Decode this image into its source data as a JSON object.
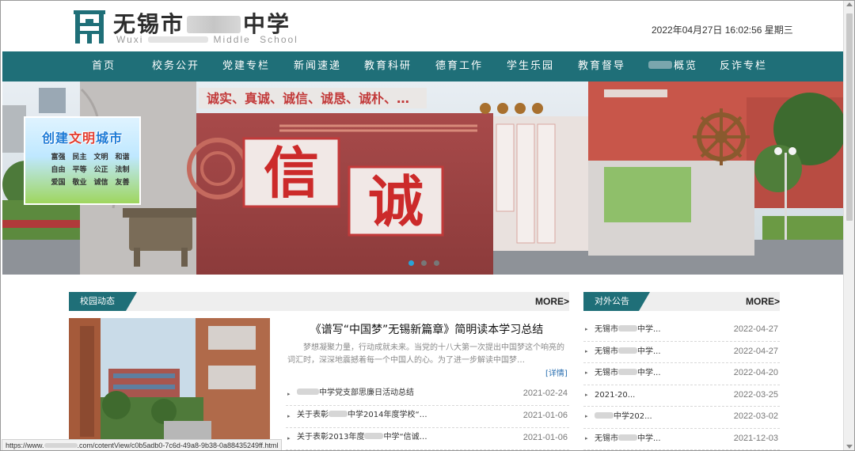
{
  "header": {
    "title_prefix": "无锡市",
    "title_suffix": "中学",
    "subtitle_prefix": "Wuxi",
    "subtitle_suffix": "Middle School",
    "datetime": "2022年04月27日 16:02:56 星期三",
    "logo_icon": "school-gate-logo-icon"
  },
  "nav": {
    "items": [
      {
        "label": "首页"
      },
      {
        "label": "校务公开"
      },
      {
        "label": "党建专栏"
      },
      {
        "label": "新闻速递"
      },
      {
        "label": "教育科研"
      },
      {
        "label": "德育工作"
      },
      {
        "label": "学生乐园"
      },
      {
        "label": "教育督导"
      },
      {
        "label": "概览"
      },
      {
        "label": "反诈专栏"
      }
    ],
    "color": "#1f6f78"
  },
  "banner": {
    "slogan_top": "诚实、真诚、诚信、诚恳、诚朴、…",
    "char_1": "信",
    "char_2": "诚",
    "civ_title_a": "创建",
    "civ_title_b": "文明",
    "civ_title_c": "城市",
    "civ_words": [
      "富强",
      "民主",
      "文明",
      "和谐",
      "自由",
      "平等",
      "公正",
      "法制",
      "爱国",
      "敬业",
      "诚信",
      "友善"
    ],
    "slide_count": 3,
    "active_slide": 1
  },
  "campus_news": {
    "tab_label": "校园动态",
    "more_label": "MORE>",
    "feature": {
      "title": "《谱写“中国梦”无锡新篇章》简明读本学习总结",
      "body": "梦想凝聚力量，行动成就未来。当党的十八大第一次提出中国梦这个响亮的词汇时，深深地震撼着每一个中国人的心。为了进一步解读中国梦…",
      "detail_label": "[详情]"
    },
    "items": [
      {
        "title": "中学党支部思廉日活动总结",
        "date": "2021-02-24"
      },
      {
        "title": "关于表彰2014年度学校…",
        "date": "2021-01-06"
      },
      {
        "title": "关于表彰2013年度中学“信诚…",
        "date": "2021-01-06"
      }
    ],
    "items_prefix": [
      "",
      "关于表彰",
      "关于表彰2013年度"
    ],
    "items_suffix": [
      "中学党支部思廉日活动总结",
      "中学2014年度学校“…",
      "中学“信诚…"
    ]
  },
  "notices": {
    "tab_label": "对外公告",
    "more_label": "MORE>",
    "items": [
      {
        "prefix": "无锡市",
        "suffix": "中学...",
        "date": "2022-04-27"
      },
      {
        "prefix": "无锡市",
        "suffix": "中学...",
        "date": "2022-04-27"
      },
      {
        "prefix": "无锡市",
        "suffix": "中学...",
        "date": "2022-04-20"
      },
      {
        "prefix": "2021-20...",
        "suffix": "",
        "date": "2022-03-25"
      },
      {
        "prefix": "",
        "suffix": "中学202...",
        "date": "2022-03-02"
      },
      {
        "prefix": "无锡市",
        "suffix": "中学...",
        "date": "2021-12-03"
      }
    ]
  },
  "status_bar": {
    "url_prefix": "https://www.",
    "url_suffix": ".com/cotentView/c0b5adb0-7c6d-49a8-9b38-0a88435249ff.html"
  }
}
